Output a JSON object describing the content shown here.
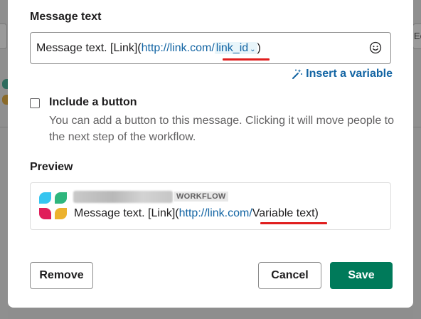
{
  "background": {
    "right_partial_text": "Ec"
  },
  "message": {
    "label": "Message text",
    "text_prefix": "Message text. [Link](",
    "link_base": "http://link.com/",
    "variable_token": "link_id",
    "text_suffix": ")",
    "emoji_icon": "smiley-face-icon",
    "insert_variable_label": "Insert a variable"
  },
  "include_button": {
    "checked": false,
    "label": "Include a button",
    "help": "You can add a button to this message. Clicking it will move people to the next step of the workflow."
  },
  "preview": {
    "label": "Preview",
    "badge": "WORKFLOW",
    "text_prefix": "Message text. [Link](",
    "link_base": "http://link.com/",
    "variable_text": "Variable text",
    "text_suffix": ")"
  },
  "actions": {
    "remove_label": "Remove",
    "cancel_label": "Cancel",
    "save_label": "Save"
  },
  "colors": {
    "link": "#1264a3",
    "save_button": "#007a5a",
    "annotation_underline": "#e01e1e"
  }
}
